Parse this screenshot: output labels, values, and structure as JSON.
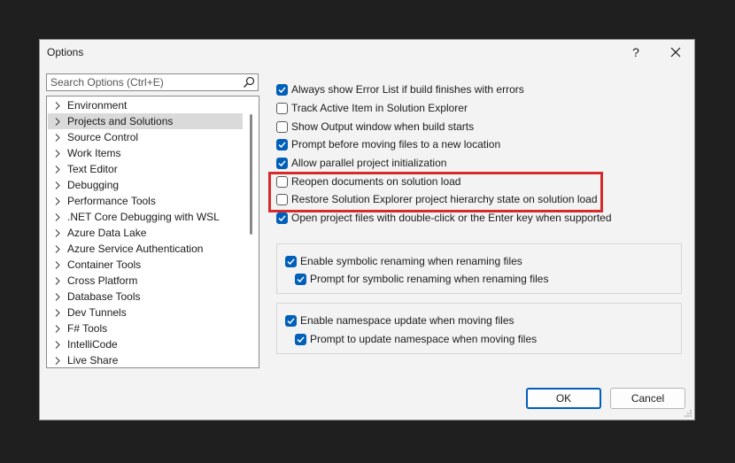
{
  "dialog": {
    "title": "Options",
    "help_glyph": "?",
    "close_glyph": "✕"
  },
  "search": {
    "placeholder": "Search Options (Ctrl+E)"
  },
  "tree": {
    "items": [
      {
        "label": "Environment"
      },
      {
        "label": "Projects and Solutions",
        "selected": true
      },
      {
        "label": "Source Control"
      },
      {
        "label": "Work Items"
      },
      {
        "label": "Text Editor"
      },
      {
        "label": "Debugging"
      },
      {
        "label": "Performance Tools"
      },
      {
        "label": ".NET Core Debugging with WSL"
      },
      {
        "label": "Azure Data Lake"
      },
      {
        "label": "Azure Service Authentication"
      },
      {
        "label": "Container Tools"
      },
      {
        "label": "Cross Platform"
      },
      {
        "label": "Database Tools"
      },
      {
        "label": "Dev Tunnels"
      },
      {
        "label": "F# Tools"
      },
      {
        "label": "IntelliCode"
      },
      {
        "label": "Live Share"
      }
    ]
  },
  "options": [
    {
      "label": "Always show Error List if build finishes with errors",
      "checked": true
    },
    {
      "label": "Track Active Item in Solution Explorer",
      "checked": false
    },
    {
      "label": "Show Output window when build starts",
      "checked": false
    },
    {
      "label": "Prompt before moving files to a new location",
      "checked": true
    },
    {
      "label": "Allow parallel project initialization",
      "checked": true
    },
    {
      "label": "Reopen documents on solution load",
      "checked": false
    },
    {
      "label": "Restore Solution Explorer project hierarchy state on solution load",
      "checked": false
    },
    {
      "label": "Open project files with double-click or the Enter key when supported",
      "checked": true
    }
  ],
  "groups": [
    {
      "main": {
        "label": "Enable symbolic renaming when renaming files",
        "checked": true
      },
      "sub": {
        "label": "Prompt for symbolic renaming when renaming files",
        "checked": true
      }
    },
    {
      "main": {
        "label": "Enable namespace update when moving files",
        "checked": true
      },
      "sub": {
        "label": "Prompt to update namespace when moving files",
        "checked": true
      }
    }
  ],
  "buttons": {
    "ok": "OK",
    "cancel": "Cancel"
  },
  "colors": {
    "accent": "#005fb8",
    "highlight_box": "#d62b2b",
    "selection": "#dadada"
  }
}
